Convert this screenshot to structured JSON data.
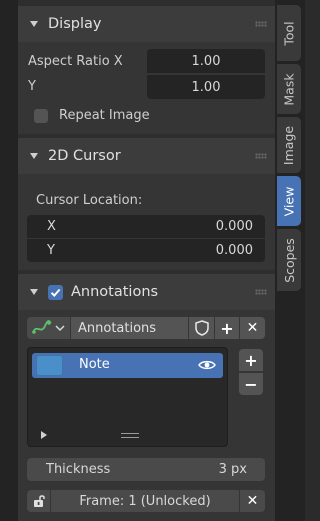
{
  "tabs": [
    {
      "label": "Tool",
      "active": false
    },
    {
      "label": "Mask",
      "active": false
    },
    {
      "label": "Image",
      "active": false
    },
    {
      "label": "View",
      "active": true
    },
    {
      "label": "Scopes",
      "active": false
    }
  ],
  "display": {
    "title": "Display",
    "aspect_x_label": "Aspect Ratio X",
    "aspect_x_value": "1.00",
    "aspect_y_label": "Y",
    "aspect_y_value": "1.00",
    "repeat_image_label": "Repeat Image",
    "repeat_image_checked": false
  },
  "cursor": {
    "title": "2D Cursor",
    "location_label": "Cursor Location:",
    "x_label": "X",
    "x_value": "0.000",
    "y_label": "Y",
    "y_value": "0.000"
  },
  "annotations": {
    "title": "Annotations",
    "enabled": true,
    "data_name": "Annotations",
    "layers": [
      {
        "name": "Note",
        "visible": true,
        "color": "#4a8fc9"
      }
    ],
    "thickness_label": "Thickness",
    "thickness_value": "3 px",
    "frame_label": "Frame: 1 (Unlocked)",
    "add_symbol": "+",
    "remove_symbol": "−",
    "close_symbol": "✕"
  },
  "colors": {
    "accent": "#4772b3",
    "panel_bg": "#353535",
    "field_bg": "#242424"
  }
}
